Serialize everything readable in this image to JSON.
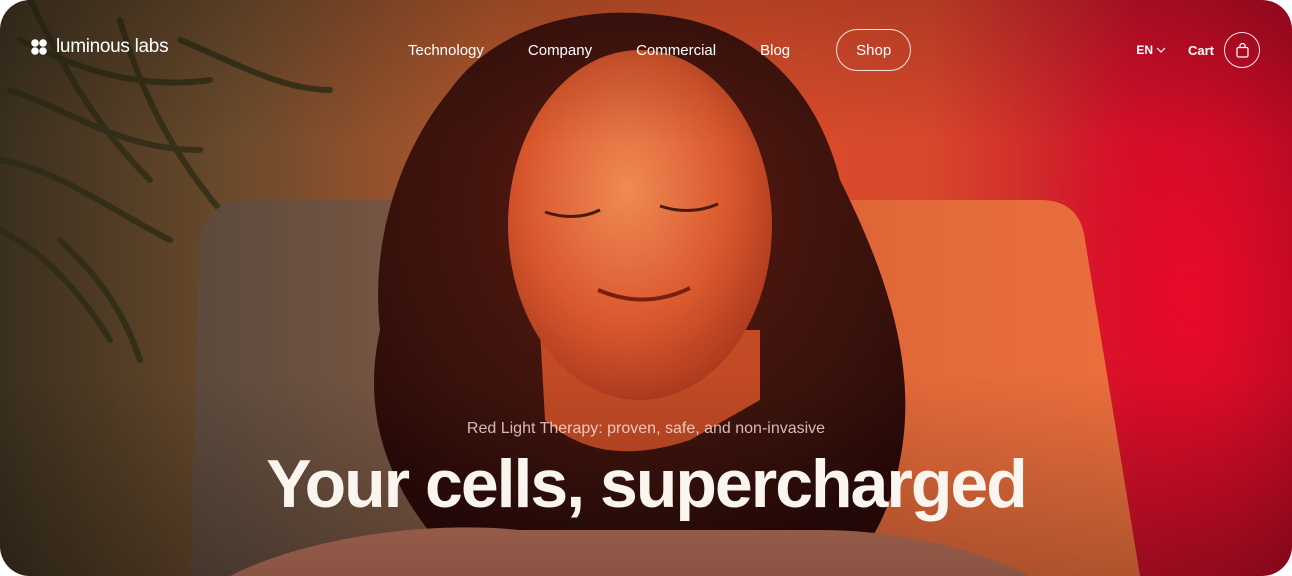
{
  "brand": {
    "name": "luminous labs",
    "logo_icon": "four-dot-cluster-icon"
  },
  "nav": {
    "links": [
      "Technology",
      "Company",
      "Commercial",
      "Blog"
    ],
    "shop_label": "Shop"
  },
  "header_right": {
    "language": "EN",
    "language_icon": "chevron-down-icon",
    "cart_label": "Cart",
    "cart_icon": "shopping-bag-icon"
  },
  "hero": {
    "eyebrow": "Red Light Therapy: proven, safe, and non-invasive",
    "headline": "Your cells, supercharged",
    "image": "woman-relaxing-under-red-light-photo"
  },
  "colors": {
    "accent_red": "#c8102a",
    "warm_orange": "#d8502a",
    "text_light": "#ffffff"
  }
}
